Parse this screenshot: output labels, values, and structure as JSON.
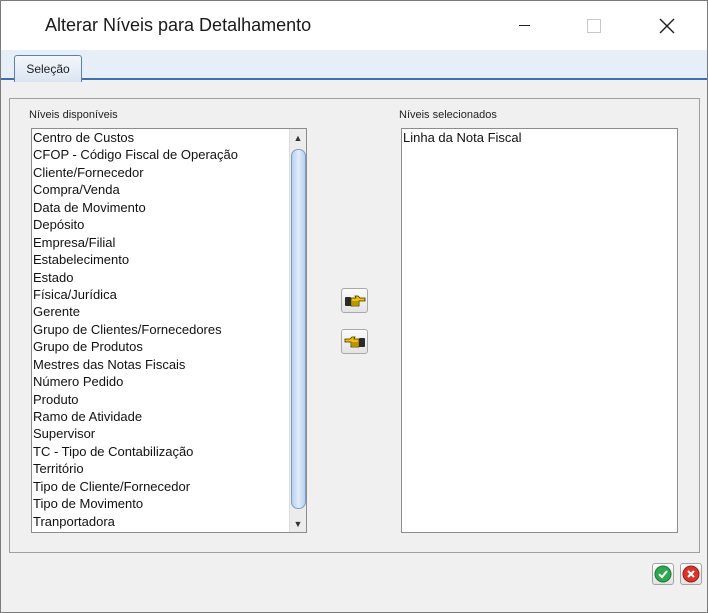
{
  "window": {
    "title": "Alterar Níveis para Detalhamento"
  },
  "tabs": [
    {
      "label": "Seleção",
      "selected": true
    }
  ],
  "available": {
    "label": "Níveis disponíveis",
    "items": [
      "Centro de Custos",
      "CFOP - Código Fiscal de Operação",
      "Cliente/Fornecedor",
      "Compra/Venda",
      "Data de Movimento",
      "Depósito",
      "Empresa/Filial",
      "Estabelecimento",
      "Estado",
      "Física/Jurídica",
      "Gerente",
      "Grupo de Clientes/Fornecedores",
      "Grupo de Produtos",
      "Mestres das Notas Fiscais",
      "Número Pedido",
      "Produto",
      "Ramo de Atividade",
      "Supervisor",
      "TC - Tipo de Contabilização",
      "Território",
      "Tipo de Cliente/Fornecedor",
      "Tipo de Movimento",
      "Tranportadora"
    ]
  },
  "selected": {
    "label": "Níveis selecionados",
    "items": [
      "Linha da Nota Fiscal"
    ]
  },
  "icons": {
    "add": "hand-pointing-right-icon",
    "remove": "hand-pointing-left-icon",
    "ok": "green-check-icon",
    "cancel": "red-x-icon"
  },
  "colors": {
    "accent": "#3f6fb0",
    "ok": "#2fa84f",
    "cancel": "#d9342b"
  }
}
